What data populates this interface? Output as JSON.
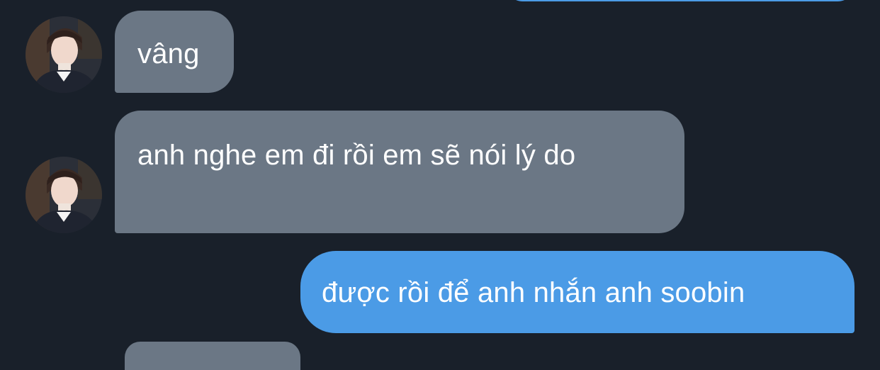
{
  "messages": [
    {
      "direction": "outgoing",
      "text": ""
    },
    {
      "direction": "incoming",
      "text": "vâng",
      "avatar": "contact-avatar"
    },
    {
      "direction": "incoming",
      "text": "anh nghe em đi rồi em sẽ nói lý do",
      "avatar": "contact-avatar"
    },
    {
      "direction": "outgoing",
      "text": "được rồi để anh nhắn anh soobin"
    },
    {
      "direction": "incoming",
      "text": ""
    }
  ],
  "colors": {
    "background": "#19202a",
    "incoming_bubble": "#6b7785",
    "outgoing_bubble": "#4b9be6",
    "text": "#ffffff"
  }
}
